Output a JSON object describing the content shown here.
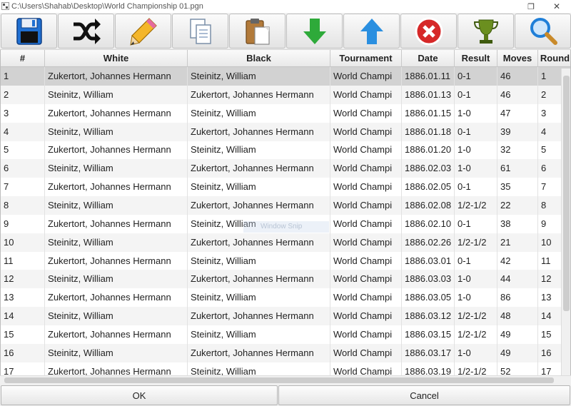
{
  "window": {
    "title": "C:\\Users\\Shahab\\Desktop\\World Championship 01.pgn",
    "restore_glyph": "❐",
    "close_glyph": "✕"
  },
  "toolbar": {
    "buttons": [
      {
        "icon": "save-icon"
      },
      {
        "icon": "shuffle-icon"
      },
      {
        "icon": "pencil-icon"
      },
      {
        "icon": "copy-icon"
      },
      {
        "icon": "paste-icon"
      },
      {
        "icon": "arrow-down-icon"
      },
      {
        "icon": "arrow-up-icon"
      },
      {
        "icon": "delete-icon"
      },
      {
        "icon": "trophy-icon"
      },
      {
        "icon": "search-icon"
      }
    ],
    "colors": {
      "save": "#1f6fd1",
      "arrow_down": "#2eaa3a",
      "arrow_up": "#2a8fe0",
      "delete": "#d62828",
      "trophy": "#6b8f1f"
    }
  },
  "table": {
    "columns": [
      "#",
      "White",
      "Black",
      "Tournament",
      "Date",
      "Result",
      "Moves",
      "Round"
    ],
    "rows": [
      [
        "1",
        "Zukertort, Johannes Hermann",
        "Steinitz, William",
        "World Champi",
        "1886.01.11",
        "0-1",
        "46",
        "1"
      ],
      [
        "2",
        "Steinitz, William",
        "Zukertort, Johannes Hermann",
        "World Champi",
        "1886.01.13",
        "0-1",
        "46",
        "2"
      ],
      [
        "3",
        "Zukertort, Johannes Hermann",
        "Steinitz, William",
        "World Champi",
        "1886.01.15",
        "1-0",
        "47",
        "3"
      ],
      [
        "4",
        "Steinitz, William",
        "Zukertort, Johannes Hermann",
        "World Champi",
        "1886.01.18",
        "0-1",
        "39",
        "4"
      ],
      [
        "5",
        "Zukertort, Johannes Hermann",
        "Steinitz, William",
        "World Champi",
        "1886.01.20",
        "1-0",
        "32",
        "5"
      ],
      [
        "6",
        "Steinitz, William",
        "Zukertort, Johannes Hermann",
        "World Champi",
        "1886.02.03",
        "1-0",
        "61",
        "6"
      ],
      [
        "7",
        "Zukertort, Johannes Hermann",
        "Steinitz, William",
        "World Champi",
        "1886.02.05",
        "0-1",
        "35",
        "7"
      ],
      [
        "8",
        "Steinitz, William",
        "Zukertort, Johannes Hermann",
        "World Champi",
        "1886.02.08",
        "1/2-1/2",
        "22",
        "8"
      ],
      [
        "9",
        "Zukertort, Johannes Hermann",
        "Steinitz, William",
        "World Champi",
        "1886.02.10",
        "0-1",
        "38",
        "9"
      ],
      [
        "10",
        "Steinitz, William",
        "Zukertort, Johannes Hermann",
        "World Champi",
        "1886.02.26",
        "1/2-1/2",
        "21",
        "10"
      ],
      [
        "11",
        "Zukertort, Johannes Hermann",
        "Steinitz, William",
        "World Champi",
        "1886.03.01",
        "0-1",
        "42",
        "11"
      ],
      [
        "12",
        "Steinitz, William",
        "Zukertort, Johannes Hermann",
        "World Champi",
        "1886.03.03",
        "1-0",
        "44",
        "12"
      ],
      [
        "13",
        "Zukertort, Johannes Hermann",
        "Steinitz, William",
        "World Champi",
        "1886.03.05",
        "1-0",
        "86",
        "13"
      ],
      [
        "14",
        "Steinitz, William",
        "Zukertort, Johannes Hermann",
        "World Champi",
        "1886.03.12",
        "1/2-1/2",
        "48",
        "14"
      ],
      [
        "15",
        "Zukertort, Johannes Hermann",
        "Steinitz, William",
        "World Champi",
        "1886.03.15",
        "1/2-1/2",
        "49",
        "15"
      ],
      [
        "16",
        "Steinitz, William",
        "Zukertort, Johannes Hermann",
        "World Champi",
        "1886.03.17",
        "1-0",
        "49",
        "16"
      ],
      [
        "17",
        "Zukertort, Johannes Hermann",
        "Steinitz, William",
        "World Champi",
        "1886.03.19",
        "1/2-1/2",
        "52",
        "17"
      ]
    ],
    "selected_row": 0
  },
  "overlay_text": "Window Snip",
  "buttons": {
    "ok": "OK",
    "cancel": "Cancel"
  }
}
